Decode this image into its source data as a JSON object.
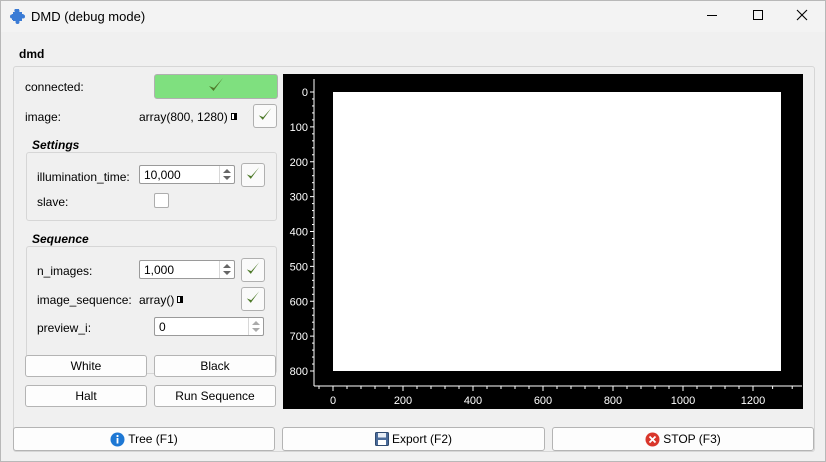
{
  "window": {
    "title": "DMD (debug mode)",
    "icons": {
      "app": "puzzle-icon",
      "minimize": "minimize-icon",
      "maximize": "maximize-icon",
      "close": "close-icon"
    }
  },
  "group": {
    "title": "dmd"
  },
  "connected": {
    "label": "connected:",
    "status_color": "#7fe07f",
    "icon": "check-icon"
  },
  "image": {
    "label": "image:",
    "value": "array(800, 1280)"
  },
  "settings": {
    "title": "Settings",
    "illumination_time": {
      "label": "illumination_time:",
      "value": "10,000"
    },
    "slave": {
      "label": "slave:",
      "checked": false
    }
  },
  "sequence": {
    "title": "Sequence",
    "n_images": {
      "label": "n_images:",
      "value": "1,000"
    },
    "image_sequence": {
      "label": "image_sequence:",
      "value": "array()"
    },
    "preview_i": {
      "label": "preview_i:",
      "value": "0"
    }
  },
  "buttons": {
    "white": "White",
    "black": "Black",
    "halt": "Halt",
    "run_sequence": "Run Sequence"
  },
  "bottom": {
    "tree": "Tree (F1)",
    "export": "Export (F2)",
    "stop": "STOP (F3)"
  },
  "colors": {
    "accent_check": "#4e7a2a",
    "info_blue": "#1e78d4",
    "stop_red": "#d9362b"
  },
  "chart_data": {
    "type": "heatmap",
    "description_values": {
      "image_rows": 800,
      "image_cols": 1280,
      "fill": "white"
    },
    "x_ticks": [
      "0",
      "200",
      "400",
      "600",
      "800",
      "1000",
      "1200"
    ],
    "y_ticks": [
      "0",
      "100",
      "200",
      "300",
      "400",
      "500",
      "600",
      "700",
      "800"
    ],
    "xlim": [
      0,
      1280
    ],
    "ylim": [
      800,
      0
    ]
  }
}
